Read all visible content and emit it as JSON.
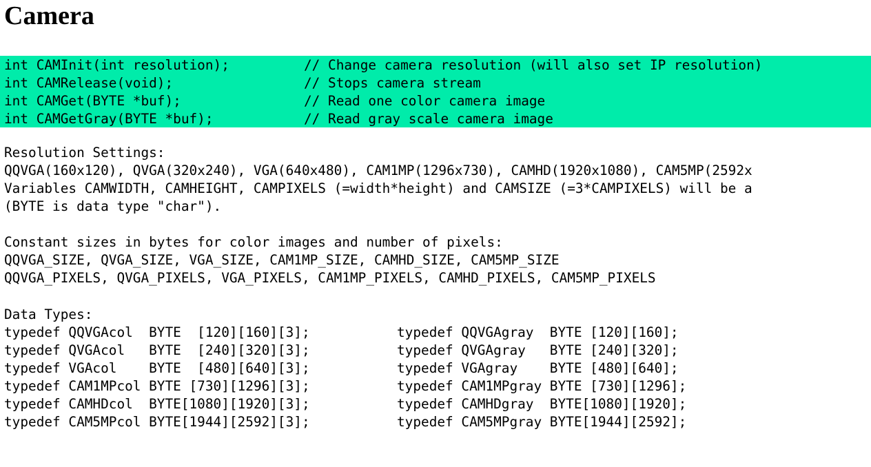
{
  "title": "Camera",
  "colors": {
    "api_block_background": "#00ecaa",
    "text": "#000000",
    "page_background": "#ffffff"
  },
  "api": [
    {
      "signature": "int CAMInit(int resolution);",
      "comment": "// Change camera resolution (will also set IP resolution)"
    },
    {
      "signature": "int CAMRelease(void);",
      "comment": "// Stops camera stream"
    },
    {
      "signature": "int CAMGet(BYTE *buf);",
      "comment": "// Read one color camera image"
    },
    {
      "signature": "int CAMGetGray(BYTE *buf);",
      "comment": "// Read gray scale camera image"
    }
  ],
  "resolution": {
    "heading": "Resolution Settings:",
    "lines": [
      "QQVGA(160x120), QVGA(320x240), VGA(640x480), CAM1MP(1296x730), CAMHD(1920x1080), CAM5MP(2592x",
      "Variables CAMWIDTH, CAMHEIGHT, CAMPIXELS (=width*height) and CAMSIZE (=3*CAMPIXELS) will be a",
      "(BYTE is data type \"char\")."
    ]
  },
  "constants": {
    "heading": "Constant sizes in bytes for color images and number of pixels:",
    "lines": [
      "QQVGA_SIZE, QVGA_SIZE, VGA_SIZE, CAM1MP_SIZE, CAMHD_SIZE, CAM5MP_SIZE",
      "QQVGA_PIXELS, QVGA_PIXELS, VGA_PIXELS, CAM1MP_PIXELS, CAMHD_PIXELS, CAM5MP_PIXELS"
    ]
  },
  "data_types": {
    "heading": "Data Types:",
    "rows": [
      {
        "color": "typedef QQVGAcol  BYTE  [120][160][3];",
        "gray": "typedef QQVGAgray  BYTE [120][160];"
      },
      {
        "color": "typedef QVGAcol   BYTE  [240][320][3];",
        "gray": "typedef QVGAgray   BYTE [240][320];"
      },
      {
        "color": "typedef VGAcol    BYTE  [480][640][3];",
        "gray": "typedef VGAgray    BYTE [480][640];"
      },
      {
        "color": "typedef CAM1MPcol BYTE [730][1296][3];",
        "gray": "typedef CAM1MPgray BYTE [730][1296];"
      },
      {
        "color": "typedef CAMHDcol  BYTE[1080][1920][3];",
        "gray": "typedef CAMHDgray  BYTE[1080][1920];"
      },
      {
        "color": "typedef CAM5MPcol BYTE[1944][2592][3];",
        "gray": "typedef CAM5MPgray BYTE[1944][2592];"
      }
    ]
  }
}
